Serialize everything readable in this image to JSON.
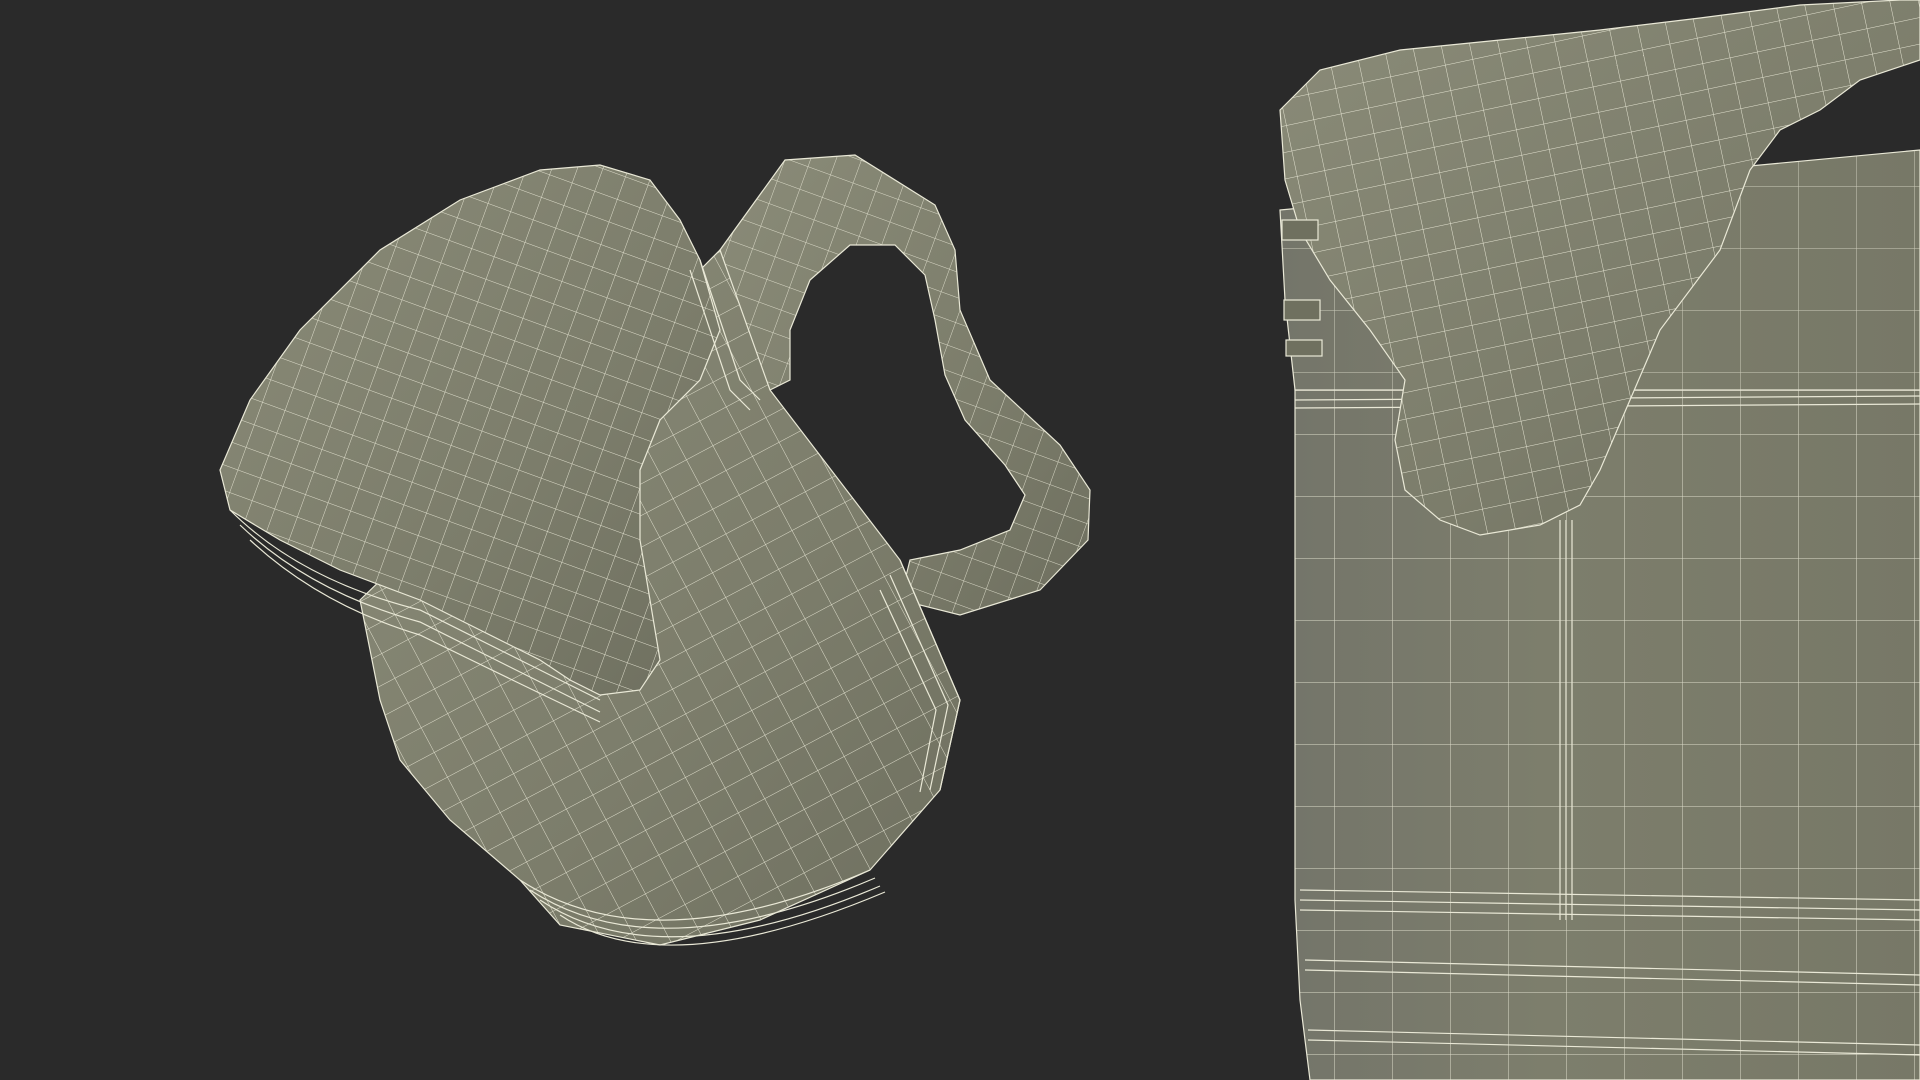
{
  "scene": {
    "background_color": "#2a2a2a",
    "mesh_fill_color": "#7c7d6b",
    "mesh_shade_color": "#6e6f5f",
    "mesh_highlight_color": "#8a8b78",
    "wire_color": "#e9e8d6"
  },
  "objects": [
    {
      "name": "pitcher-left-view"
    },
    {
      "name": "pitcher-right-closeup"
    }
  ]
}
